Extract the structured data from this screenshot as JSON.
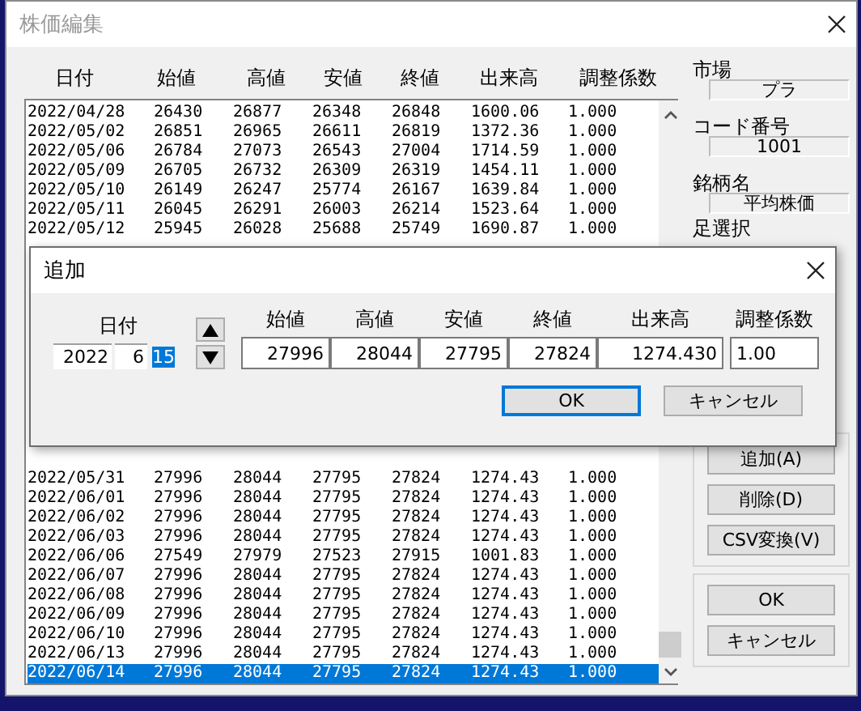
{
  "window": {
    "title": "株価編集"
  },
  "columns": [
    "日付",
    "始値",
    "高値",
    "安値",
    "終値",
    "出来高",
    "調整係数"
  ],
  "rows_top": [
    {
      "cells": [
        "2022/04/28",
        "26430",
        "26877",
        "26348",
        "26848",
        "1600.06",
        "1.000"
      ],
      "selected": false
    },
    {
      "cells": [
        "2022/05/02",
        "26851",
        "26965",
        "26611",
        "26819",
        "1372.36",
        "1.000"
      ],
      "selected": false
    },
    {
      "cells": [
        "2022/05/06",
        "26784",
        "27073",
        "26543",
        "27004",
        "1714.59",
        "1.000"
      ],
      "selected": false
    },
    {
      "cells": [
        "2022/05/09",
        "26705",
        "26732",
        "26309",
        "26319",
        "1454.11",
        "1.000"
      ],
      "selected": false
    },
    {
      "cells": [
        "2022/05/10",
        "26149",
        "26247",
        "25774",
        "26167",
        "1639.84",
        "1.000"
      ],
      "selected": false
    },
    {
      "cells": [
        "2022/05/11",
        "26045",
        "26291",
        "26003",
        "26214",
        "1523.64",
        "1.000"
      ],
      "selected": false
    },
    {
      "cells": [
        "2022/05/12",
        "25945",
        "26028",
        "25688",
        "25749",
        "1690.87",
        "1.000"
      ],
      "selected": false
    }
  ],
  "rows_bottom": [
    {
      "cells": [
        "2022/05/31",
        "27996",
        "28044",
        "27795",
        "27824",
        "1274.43",
        "1.000"
      ],
      "selected": false
    },
    {
      "cells": [
        "2022/06/01",
        "27996",
        "28044",
        "27795",
        "27824",
        "1274.43",
        "1.000"
      ],
      "selected": false
    },
    {
      "cells": [
        "2022/06/02",
        "27996",
        "28044",
        "27795",
        "27824",
        "1274.43",
        "1.000"
      ],
      "selected": false
    },
    {
      "cells": [
        "2022/06/03",
        "27996",
        "28044",
        "27795",
        "27824",
        "1274.43",
        "1.000"
      ],
      "selected": false
    },
    {
      "cells": [
        "2022/06/06",
        "27549",
        "27979",
        "27523",
        "27915",
        "1001.83",
        "1.000"
      ],
      "selected": false
    },
    {
      "cells": [
        "2022/06/07",
        "27996",
        "28044",
        "27795",
        "27824",
        "1274.43",
        "1.000"
      ],
      "selected": false
    },
    {
      "cells": [
        "2022/06/08",
        "27996",
        "28044",
        "27795",
        "27824",
        "1274.43",
        "1.000"
      ],
      "selected": false
    },
    {
      "cells": [
        "2022/06/09",
        "27996",
        "28044",
        "27795",
        "27824",
        "1274.43",
        "1.000"
      ],
      "selected": false
    },
    {
      "cells": [
        "2022/06/10",
        "27996",
        "28044",
        "27795",
        "27824",
        "1274.43",
        "1.000"
      ],
      "selected": false
    },
    {
      "cells": [
        "2022/06/13",
        "27996",
        "28044",
        "27795",
        "27824",
        "1274.43",
        "1.000"
      ],
      "selected": false
    },
    {
      "cells": [
        "2022/06/14",
        "27996",
        "28044",
        "27795",
        "27824",
        "1274.43",
        "1.000"
      ],
      "selected": true
    }
  ],
  "side": {
    "market_label": "市場",
    "market": "プラ",
    "code_label": "コード番号",
    "code": "1001",
    "name_label": "銘柄名",
    "name": "平均株価",
    "ashi_label": "足選択"
  },
  "edit_buttons": [
    "追加(A)",
    "削除(D)",
    "CSV変換(V)"
  ],
  "main_buttons": [
    "OK",
    "キャンセル"
  ],
  "add_dialog": {
    "title": "追加",
    "date_label": "日付",
    "date_parts": [
      {
        "value": "2022",
        "selected": false
      },
      {
        "value": "6",
        "selected": false
      },
      {
        "value": "15",
        "selected": true
      }
    ],
    "fields": [
      {
        "label": "始値",
        "value": "27996"
      },
      {
        "label": "高値",
        "value": "28044"
      },
      {
        "label": "安値",
        "value": "27795"
      },
      {
        "label": "終値",
        "value": "27824"
      },
      {
        "label": "出来高",
        "value": "1274.430"
      },
      {
        "label": "調整係数",
        "value": "1.00"
      }
    ],
    "buttons": [
      {
        "label": "OK",
        "default": true
      },
      {
        "label": "キャンセル",
        "default": false
      }
    ]
  }
}
